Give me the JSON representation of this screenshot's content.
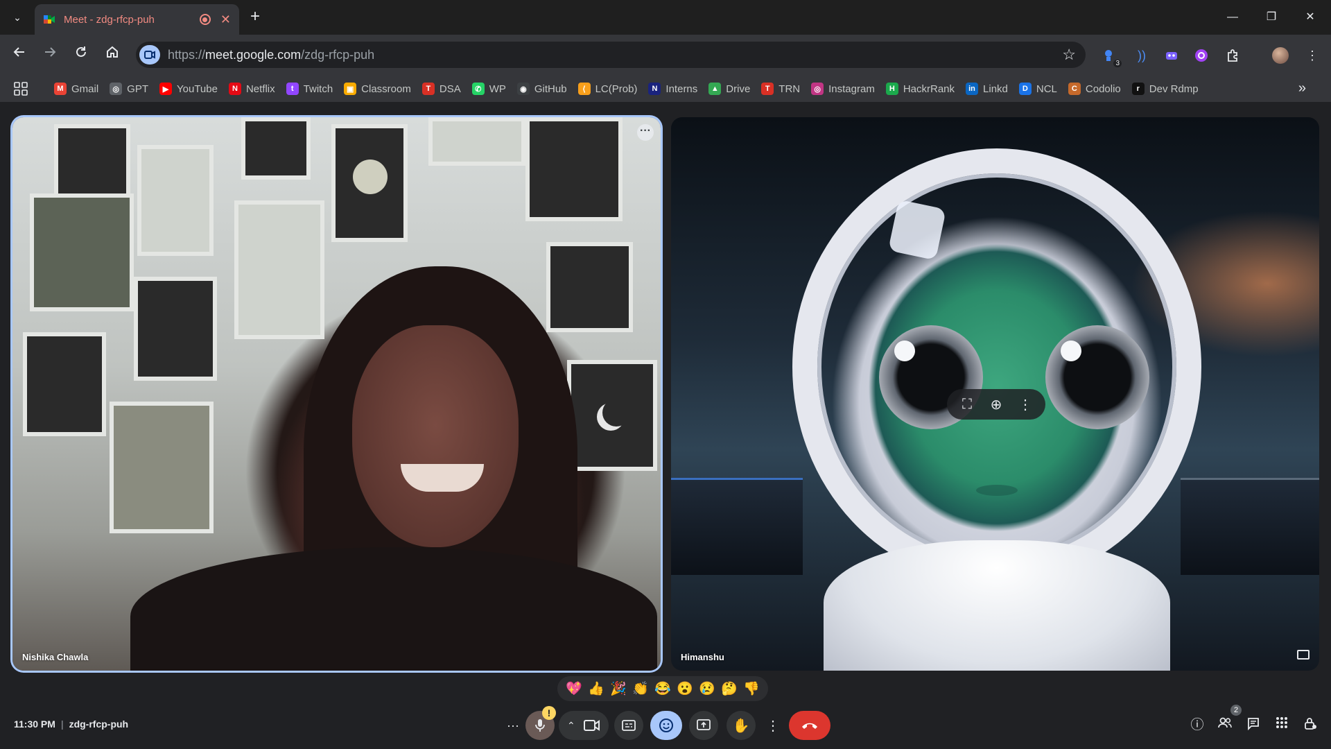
{
  "browser": {
    "tab": {
      "title": "Meet - zdg-rfcp-puh",
      "close_glyph": "✕"
    },
    "new_tab_glyph": "+",
    "window": {
      "minimize": "—",
      "restore": "❐",
      "close": "✕"
    },
    "omnibox": {
      "scheme": "https://",
      "host": "meet.google.com",
      "path": "/zdg-rfcp-puh"
    },
    "extension_badge": "3"
  },
  "bookmarks": [
    {
      "label": "Gmail",
      "icon": "gmail-icon",
      "color": "#ea4335",
      "glyph": "M"
    },
    {
      "label": "GPT",
      "icon": "openai-icon",
      "color": "#5f6368",
      "glyph": "◎"
    },
    {
      "label": "YouTube",
      "icon": "youtube-icon",
      "color": "#ff0000",
      "glyph": "▶"
    },
    {
      "label": "Netflix",
      "icon": "netflix-icon",
      "color": "#e50914",
      "glyph": "N"
    },
    {
      "label": "Twitch",
      "icon": "twitch-icon",
      "color": "#9146ff",
      "glyph": "t"
    },
    {
      "label": "Classroom",
      "icon": "classroom-icon",
      "color": "#f9ab00",
      "glyph": "▣"
    },
    {
      "label": "DSA",
      "icon": "tuf-icon",
      "color": "#d93025",
      "glyph": "T"
    },
    {
      "label": "WP",
      "icon": "whatsapp-icon",
      "color": "#25d366",
      "glyph": "✆"
    },
    {
      "label": "GitHub",
      "icon": "github-icon",
      "color": "#3c4043",
      "glyph": "◉"
    },
    {
      "label": "LC(Prob)",
      "icon": "leetcode-icon",
      "color": "#f89f1b",
      "glyph": "⟨"
    },
    {
      "label": "Interns",
      "icon": "internshala-icon",
      "color": "#1a237e",
      "glyph": "N"
    },
    {
      "label": "Drive",
      "icon": "drive-icon",
      "color": "#34a853",
      "glyph": "▲"
    },
    {
      "label": "TRN",
      "icon": "trn-icon",
      "color": "#d93025",
      "glyph": "T"
    },
    {
      "label": "Instagram",
      "icon": "instagram-icon",
      "color": "#c13584",
      "glyph": "◎"
    },
    {
      "label": "HackrRank",
      "icon": "hackerrank-icon",
      "color": "#1ba94c",
      "glyph": "H"
    },
    {
      "label": "Linkd",
      "icon": "linkedin-icon",
      "color": "#0a66c2",
      "glyph": "in"
    },
    {
      "label": "NCL",
      "icon": "ncl-icon",
      "color": "#1a73e8",
      "glyph": "D"
    },
    {
      "label": "Codolio",
      "icon": "codolio-icon",
      "color": "#c5692b",
      "glyph": "C"
    },
    {
      "label": "Dev Rdmp",
      "icon": "roadmap-icon",
      "color": "#111111",
      "glyph": "r"
    }
  ],
  "meet": {
    "participants": [
      {
        "name": "Nishika Chawla",
        "active_speaker": true
      },
      {
        "name": "Himanshu",
        "active_speaker": false
      }
    ],
    "tile_controls": [
      "⛶",
      "⊕",
      "⋮"
    ],
    "reactions": [
      "💖",
      "👍",
      "🎉",
      "👏",
      "😂",
      "😮",
      "😢",
      "🤔",
      "👎"
    ],
    "time": "11:30 PM",
    "separator": "|",
    "meeting_code": "zdg-rfcp-puh",
    "people_count": "2",
    "mic_warning": "!",
    "colors": {
      "accent": "#a8c7fa",
      "end_call": "#dc362e",
      "warning": "#fdd663"
    }
  }
}
